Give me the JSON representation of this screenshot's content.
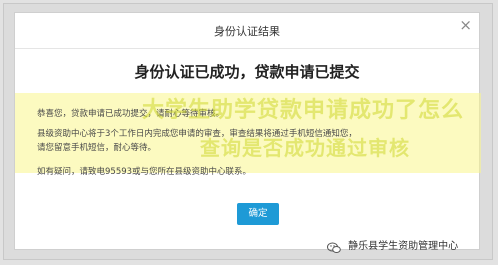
{
  "dialog": {
    "header_title": "身份认证结果",
    "close_symbol": "×",
    "headline": "身份认证已成功，贷款申请已提交",
    "lines": [
      "恭喜您，贷款申请已成功提交，请耐心等待审核。",
      "县级资助中心将于3个工作日内完成您申请的审查，审查结果将通过手机短信通知您，",
      "请您留意手机短信，耐心等待。",
      "如有疑问，请致电95593或与您所在县级资助中心联系。"
    ],
    "ok_label": "确定"
  },
  "watermark": {
    "line1": "大学生助学贷款申请成功了怎么",
    "line2": "查询是否成功通过审核"
  },
  "brand": {
    "name": "静乐县学生资助管理中心",
    "icon": "wechat-icon"
  }
}
